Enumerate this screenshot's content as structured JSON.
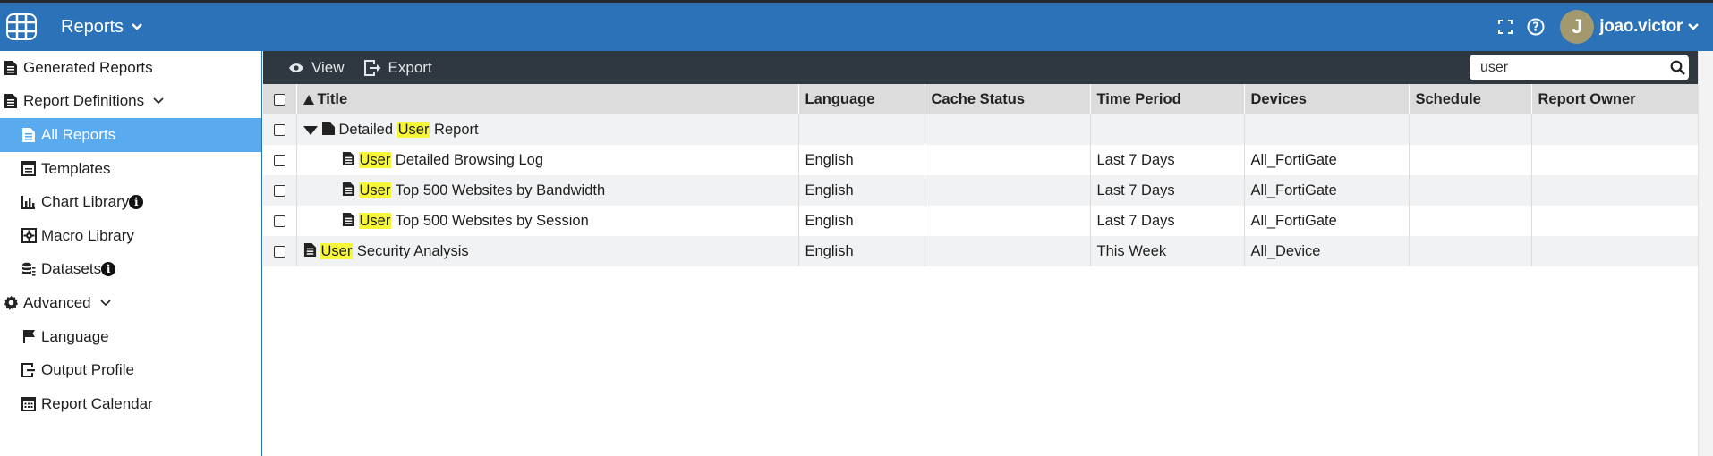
{
  "header": {
    "app_title": "Reports",
    "user_initial": "J",
    "username": "joao.victor"
  },
  "sidebar": {
    "items": [
      {
        "label": "Generated Reports",
        "icon": "report-doc-icon"
      },
      {
        "label": "Report Definitions",
        "icon": "report-doc-icon"
      },
      {
        "label": "All Reports",
        "icon": "report-doc-icon"
      },
      {
        "label": "Templates",
        "icon": "template-icon"
      },
      {
        "label": "Chart Library",
        "icon": "bar-chart-icon"
      },
      {
        "label": "Macro Library",
        "icon": "macro-gear-icon"
      },
      {
        "label": "Datasets",
        "icon": "dataset-icon"
      },
      {
        "label": "Advanced",
        "icon": "gear-icon"
      },
      {
        "label": "Language",
        "icon": "flag-icon"
      },
      {
        "label": "Output Profile",
        "icon": "output-icon"
      },
      {
        "label": "Report Calendar",
        "icon": "calendar-icon"
      }
    ]
  },
  "toolbar": {
    "view_label": "View",
    "export_label": "Export",
    "search_value": "user"
  },
  "table": {
    "columns": [
      "Title",
      "Language",
      "Cache Status",
      "Time Period",
      "Devices",
      "Schedule",
      "Report Owner"
    ],
    "rows": [
      {
        "pre": "Detailed ",
        "hl": "User",
        "post": " Report",
        "language": "",
        "cache": "",
        "period": "",
        "devices": "",
        "schedule": "",
        "owner": ""
      },
      {
        "pre": "",
        "hl": "User",
        "post": " Detailed Browsing Log",
        "language": "English",
        "cache": "",
        "period": "Last 7 Days",
        "devices": "All_FortiGate",
        "schedule": "",
        "owner": ""
      },
      {
        "pre": "",
        "hl": "User",
        "post": " Top 500 Websites by Bandwidth",
        "language": "English",
        "cache": "",
        "period": "Last 7 Days",
        "devices": "All_FortiGate",
        "schedule": "",
        "owner": ""
      },
      {
        "pre": "",
        "hl": "User",
        "post": " Top 500 Websites by Session",
        "language": "English",
        "cache": "",
        "period": "Last 7 Days",
        "devices": "All_FortiGate",
        "schedule": "",
        "owner": ""
      },
      {
        "pre": "",
        "hl": "User",
        "post": " Security Analysis",
        "language": "English",
        "cache": "",
        "period": "This Week",
        "devices": "All_Device",
        "schedule": "",
        "owner": ""
      }
    ]
  },
  "colors": {
    "topbar": "#2b72b8",
    "toolbar": "#2f3740",
    "active_item": "#5aaaf0",
    "highlight": "#f7f73a"
  }
}
